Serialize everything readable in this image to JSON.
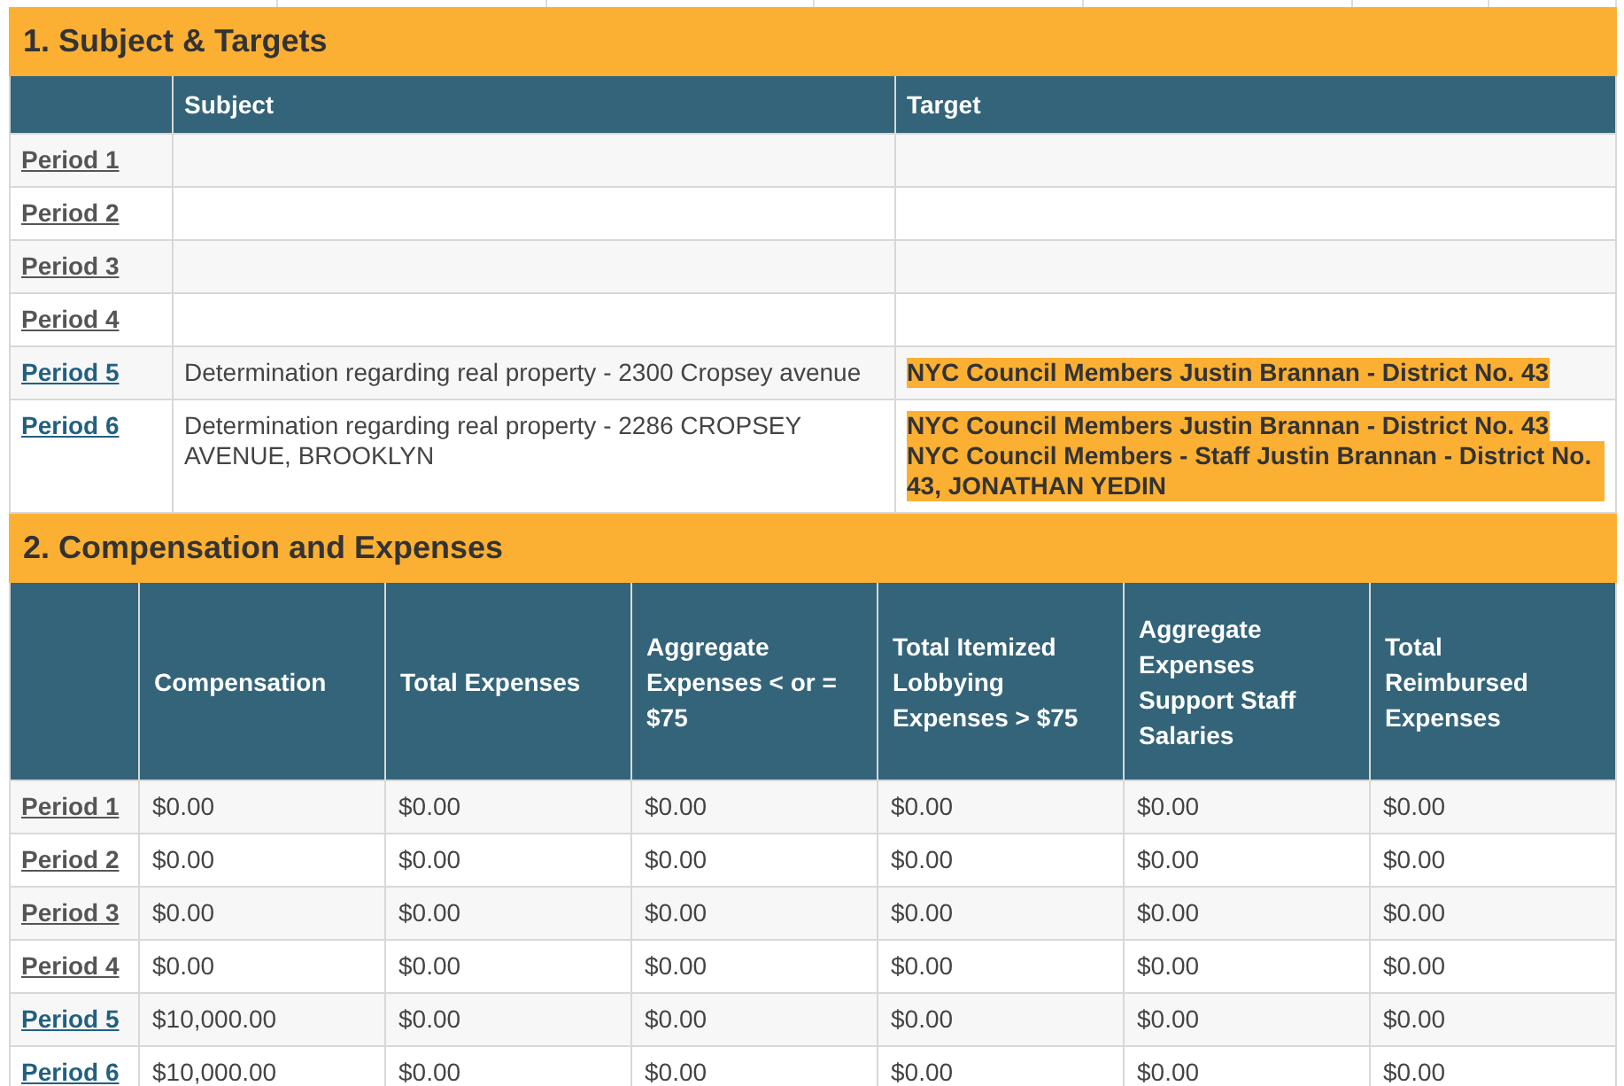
{
  "subject_targets": {
    "title": "1. Subject & Targets",
    "columns": [
      "Subject",
      "Target"
    ],
    "rows": [
      {
        "period": "Period 1",
        "has_filing": false
      },
      {
        "period": "Period 2",
        "has_filing": false
      },
      {
        "period": "Period 3",
        "has_filing": false
      },
      {
        "period": "Period 4",
        "has_filing": false
      },
      {
        "period": "Period 5",
        "has_filing": true,
        "subject": "Determination regarding real property - 2300 Cropsey avenue",
        "targets": [
          "NYC Council Members Justin Brannan - District No. 43"
        ]
      },
      {
        "period": "Period 6",
        "has_filing": true,
        "subject": "Determination regarding real property - 2286 CROPSEY AVENUE, BROOKLYN",
        "targets": [
          "NYC Council Members Justin Brannan - District No. 43",
          "NYC Council Members - Staff Justin Brannan - District No. 43, JONATHAN YEDIN"
        ]
      }
    ]
  },
  "compensation_expenses": {
    "title": "2. Compensation and Expenses",
    "columns": [
      "Compensation",
      "Total Expenses",
      "Aggregate Expenses < or = $75",
      "Total Itemized Lobbying Expenses > $75",
      "Aggregate Expenses Support Staff Salaries",
      "Total Reimbursed Expenses"
    ],
    "rows": [
      {
        "period": "Period 1",
        "has_filing": false,
        "values": [
          "$0.00",
          "$0.00",
          "$0.00",
          "$0.00",
          "$0.00",
          "$0.00"
        ]
      },
      {
        "period": "Period 2",
        "has_filing": false,
        "values": [
          "$0.00",
          "$0.00",
          "$0.00",
          "$0.00",
          "$0.00",
          "$0.00"
        ]
      },
      {
        "period": "Period 3",
        "has_filing": false,
        "values": [
          "$0.00",
          "$0.00",
          "$0.00",
          "$0.00",
          "$0.00",
          "$0.00"
        ]
      },
      {
        "period": "Period 4",
        "has_filing": false,
        "values": [
          "$0.00",
          "$0.00",
          "$0.00",
          "$0.00",
          "$0.00",
          "$0.00"
        ]
      },
      {
        "period": "Period 5",
        "has_filing": true,
        "values": [
          "$10,000.00",
          "$0.00",
          "$0.00",
          "$0.00",
          "$0.00",
          "$0.00"
        ]
      },
      {
        "period": "Period 6",
        "has_filing": true,
        "values": [
          "$10,000.00",
          "$0.00",
          "$0.00",
          "$0.00",
          "$0.00",
          "$0.00"
        ]
      }
    ]
  }
}
